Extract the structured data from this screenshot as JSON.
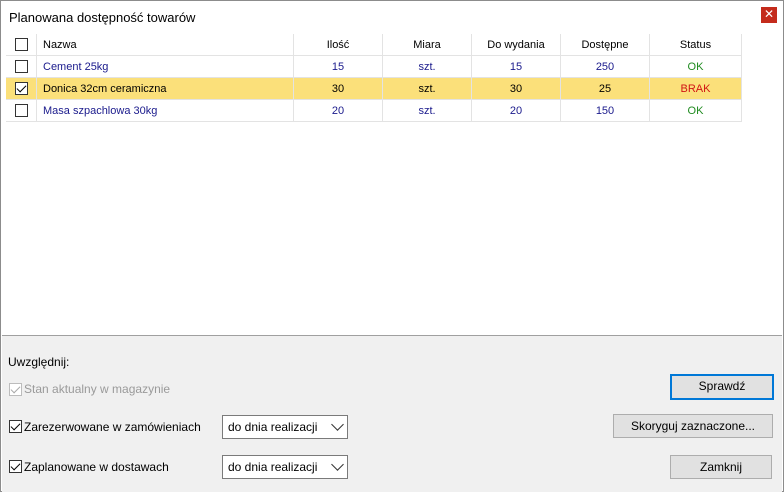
{
  "window": {
    "title": "Planowana dostępność towarów",
    "close_glyph": "✕"
  },
  "table": {
    "headers": {
      "name": "Nazwa",
      "qty": "Ilość",
      "unit": "Miara",
      "to_issue": "Do wydania",
      "available": "Dostępne",
      "status": "Status"
    },
    "rows": [
      {
        "checked": false,
        "name": "Cement 25kg",
        "qty": "15",
        "unit": "szt.",
        "to_issue": "15",
        "available": "250",
        "status": "OK"
      },
      {
        "checked": true,
        "name": "Donica 32cm ceramiczna",
        "qty": "30",
        "unit": "szt.",
        "to_issue": "30",
        "available": "25",
        "status": "BRAK"
      },
      {
        "checked": false,
        "name": "Masa szpachlowa 30kg",
        "qty": "20",
        "unit": "szt.",
        "to_issue": "20",
        "available": "150",
        "status": "OK"
      }
    ]
  },
  "options": {
    "heading": "Uwzględnij:",
    "stock": {
      "label": "Stan aktualny w magazynie",
      "checked": true,
      "disabled": true
    },
    "reserved": {
      "label": "Zarezerwowane w zamówieniach",
      "checked": true,
      "select_value": "do dnia realizacji"
    },
    "planned": {
      "label": "Zaplanowane w dostawach",
      "checked": true,
      "select_value": "do dnia realizacji"
    }
  },
  "buttons": {
    "check": "Sprawdź",
    "correct": "Skoryguj zaznaczone...",
    "close": "Zamknij"
  },
  "colors": {
    "selected_row": "#fbe07a",
    "ok": "#1f8b1f",
    "brak": "#d11414",
    "focus_border": "#0078d7"
  }
}
